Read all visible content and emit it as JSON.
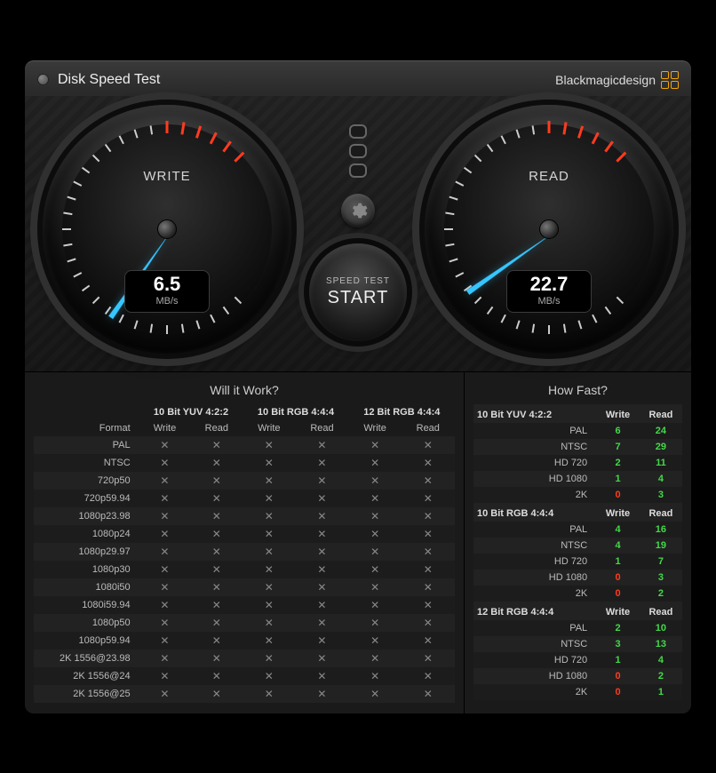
{
  "header": {
    "title": "Disk Speed Test",
    "brand": "Blackmagicdesign"
  },
  "gauges": {
    "unit": "MB/s",
    "write": {
      "label": "WRITE",
      "value": "6.5",
      "needle_rotation_deg": 35
    },
    "read": {
      "label": "READ",
      "value": "22.7",
      "needle_rotation_deg": 55
    }
  },
  "center": {
    "sub": "SPEED TEST",
    "main": "START"
  },
  "will_it_work": {
    "title": "Will it Work?",
    "group_headers": [
      "10 Bit YUV 4:2:2",
      "10 Bit RGB 4:4:4",
      "12 Bit RGB 4:4:4"
    ],
    "sub_headers": [
      "Format",
      "Write",
      "Read",
      "Write",
      "Read",
      "Write",
      "Read"
    ],
    "formats": [
      "PAL",
      "NTSC",
      "720p50",
      "720p59.94",
      "1080p23.98",
      "1080p24",
      "1080p29.97",
      "1080p30",
      "1080i50",
      "1080i59.94",
      "1080p50",
      "1080p59.94",
      "2K 1556@23.98",
      "2K 1556@24",
      "2K 1556@25"
    ]
  },
  "how_fast": {
    "title": "How Fast?",
    "sections": [
      {
        "name": "10 Bit YUV 4:2:2",
        "col_w": "Write",
        "col_r": "Read",
        "rows": [
          {
            "fmt": "PAL",
            "w": "6",
            "r": "24"
          },
          {
            "fmt": "NTSC",
            "w": "7",
            "r": "29"
          },
          {
            "fmt": "HD 720",
            "w": "2",
            "r": "11"
          },
          {
            "fmt": "HD 1080",
            "w": "1",
            "r": "4"
          },
          {
            "fmt": "2K",
            "w": "0",
            "r": "3"
          }
        ]
      },
      {
        "name": "10 Bit RGB 4:4:4",
        "col_w": "Write",
        "col_r": "Read",
        "rows": [
          {
            "fmt": "PAL",
            "w": "4",
            "r": "16"
          },
          {
            "fmt": "NTSC",
            "w": "4",
            "r": "19"
          },
          {
            "fmt": "HD 720",
            "w": "1",
            "r": "7"
          },
          {
            "fmt": "HD 1080",
            "w": "0",
            "r": "3"
          },
          {
            "fmt": "2K",
            "w": "0",
            "r": "2"
          }
        ]
      },
      {
        "name": "12 Bit RGB 4:4:4",
        "col_w": "Write",
        "col_r": "Read",
        "rows": [
          {
            "fmt": "PAL",
            "w": "2",
            "r": "10"
          },
          {
            "fmt": "NTSC",
            "w": "3",
            "r": "13"
          },
          {
            "fmt": "HD 720",
            "w": "1",
            "r": "4"
          },
          {
            "fmt": "HD 1080",
            "w": "0",
            "r": "2"
          },
          {
            "fmt": "2K",
            "w": "0",
            "r": "1"
          }
        ]
      }
    ]
  },
  "chart_data": {
    "type": "table",
    "title": "Disk Speed Test Results",
    "write_speed_mbs": 6.5,
    "read_speed_mbs": 22.7,
    "how_fast_fps": {
      "10 Bit YUV 4:2:2": {
        "PAL": [
          6,
          24
        ],
        "NTSC": [
          7,
          29
        ],
        "HD 720": [
          2,
          11
        ],
        "HD 1080": [
          1,
          4
        ],
        "2K": [
          0,
          3
        ]
      },
      "10 Bit RGB 4:4:4": {
        "PAL": [
          4,
          16
        ],
        "NTSC": [
          4,
          19
        ],
        "HD 720": [
          1,
          7
        ],
        "HD 1080": [
          0,
          3
        ],
        "2K": [
          0,
          2
        ]
      },
      "12 Bit RGB 4:4:4": {
        "PAL": [
          2,
          10
        ],
        "NTSC": [
          3,
          13
        ],
        "HD 720": [
          1,
          4
        ],
        "HD 1080": [
          0,
          2
        ],
        "2K": [
          0,
          1
        ]
      }
    }
  }
}
